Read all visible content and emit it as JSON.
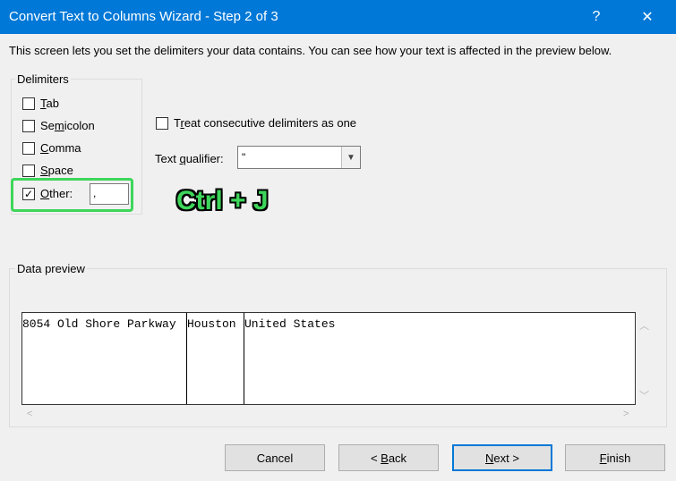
{
  "window": {
    "title": "Convert Text to Columns Wizard - Step 2 of 3",
    "help_glyph": "?",
    "close_glyph": "✕"
  },
  "intro_text": "This screen lets you set the delimiters your data contains.  You can see how your text is affected in the preview below.",
  "delimiters": {
    "group_label": "Delimiters",
    "tab": {
      "label": "Tab",
      "checked": false
    },
    "semicolon": {
      "label": "Semicolon",
      "checked": false
    },
    "comma": {
      "label": "Comma",
      "checked": false
    },
    "space": {
      "label": "Space",
      "checked": false
    },
    "other": {
      "label": "Other:",
      "checked": true,
      "value": ","
    }
  },
  "treat_consecutive": {
    "label": "Treat consecutive delimiters as one",
    "checked": false
  },
  "text_qualifier": {
    "label": "Text qualifier:",
    "value": "\""
  },
  "annotation": "Ctrl + J",
  "data_preview": {
    "group_label": "Data preview",
    "columns": [
      "8054 Old Shore Parkway",
      "Houston",
      "United States"
    ]
  },
  "buttons": {
    "cancel": "Cancel",
    "back": "< Back",
    "next": "Next >",
    "finish": "Finish"
  },
  "colors": {
    "titlebar": "#0078d7",
    "highlight": "#3dd65a"
  }
}
